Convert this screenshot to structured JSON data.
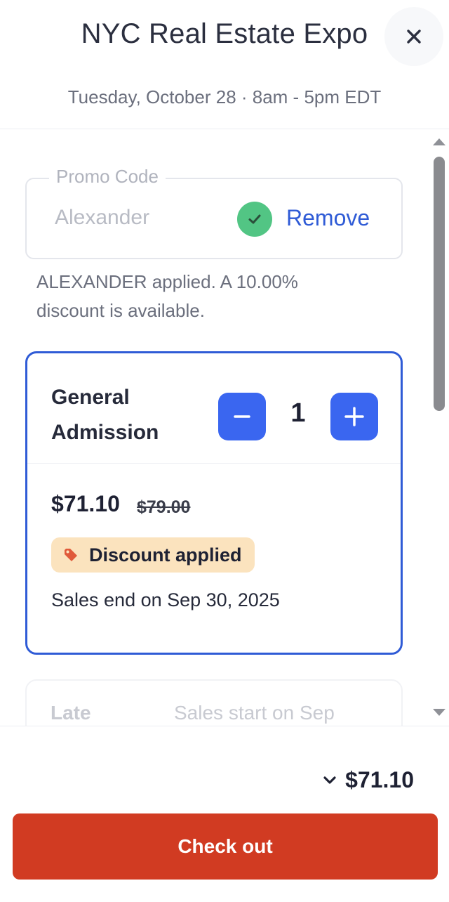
{
  "header": {
    "title": "NYC Real Estate Expo",
    "subtitle": "Tuesday, October 28 · 8am - 5pm EDT",
    "close_icon": "close-icon"
  },
  "promo": {
    "legend": "Promo Code",
    "value": "Alexander",
    "remove_label": "Remove",
    "message": "ALEXANDER applied. A 10.00% discount is available.",
    "check_color": "#52c584"
  },
  "ticket": {
    "name": "General Admission",
    "quantity": "1",
    "price": "$71.10",
    "original_price": "$79.00",
    "badge": "Discount applied",
    "sales_end": "Sales end on Sep 30, 2025",
    "accent_color": "#3a66f0"
  },
  "next_ticket": {
    "name": "Late",
    "sales_note": "Sales start on Sep"
  },
  "footer": {
    "total": "$71.10",
    "checkout_label": "Check out",
    "checkout_color": "#d13b22"
  }
}
